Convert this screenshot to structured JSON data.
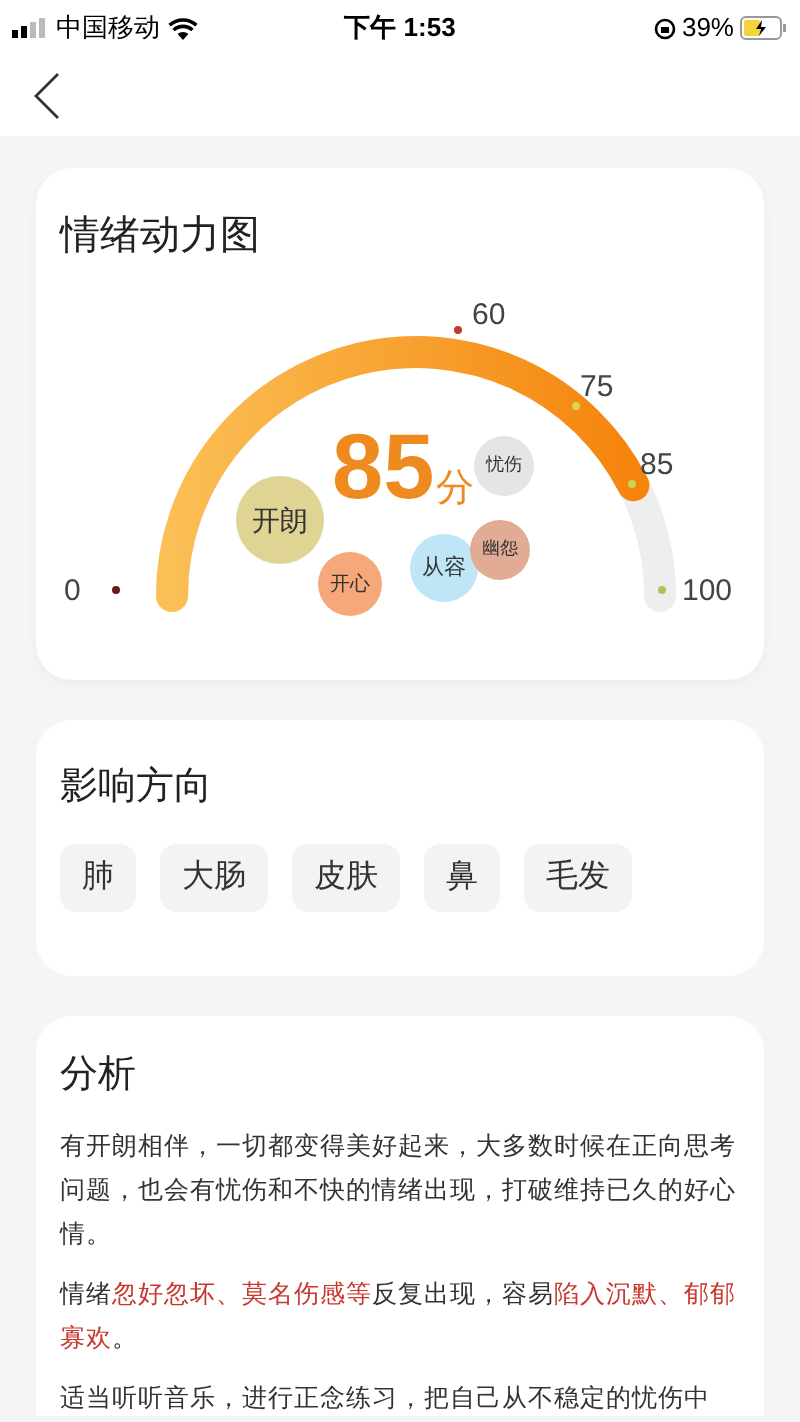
{
  "status_bar": {
    "carrier": "中国移动",
    "time": "下午 1:53",
    "battery": "39%"
  },
  "gauge_card": {
    "title": "情绪动力图",
    "score": "85",
    "unit": "分",
    "ticks": [
      {
        "label": "0",
        "color": "#6b1a1a"
      },
      {
        "label": "60",
        "color": "#c0392b"
      },
      {
        "label": "75",
        "color": "#d9d45a"
      },
      {
        "label": "85",
        "color": "#c8d45a"
      },
      {
        "label": "100",
        "color": "#a8c45a"
      }
    ],
    "bubbles": [
      {
        "label": "开朗",
        "color": "#e0d494"
      },
      {
        "label": "开心",
        "color": "#f6a87a"
      },
      {
        "label": "从容",
        "color": "#bfe6f7"
      },
      {
        "label": "幽怨",
        "color": "#e2ab94"
      },
      {
        "label": "忧伤",
        "color": "#e5e5e5"
      }
    ]
  },
  "influence_card": {
    "title": "影响方向",
    "tags": [
      "肺",
      "大肠",
      "皮肤",
      "鼻",
      "毛发"
    ]
  },
  "analysis_card": {
    "title": "分析",
    "paragraphs": [
      [
        {
          "text": "有开朗相伴，一切都变得美好起来，大多数时候在正向思考问题，也会有忧伤和不快的情绪出现，打破维持已久的好心情。",
          "highlight": false
        }
      ],
      [
        {
          "text": "情绪",
          "highlight": false
        },
        {
          "text": "忽好忽坏、莫名伤感等",
          "highlight": true
        },
        {
          "text": "反复出现，容易",
          "highlight": false
        },
        {
          "text": "陷入沉默、郁郁寡欢",
          "highlight": true
        },
        {
          "text": "。",
          "highlight": false
        }
      ],
      [
        {
          "text": "适当听听音乐，进行正念练习，把自己从不稳定的忧伤中",
          "highlight": false
        }
      ]
    ]
  }
}
